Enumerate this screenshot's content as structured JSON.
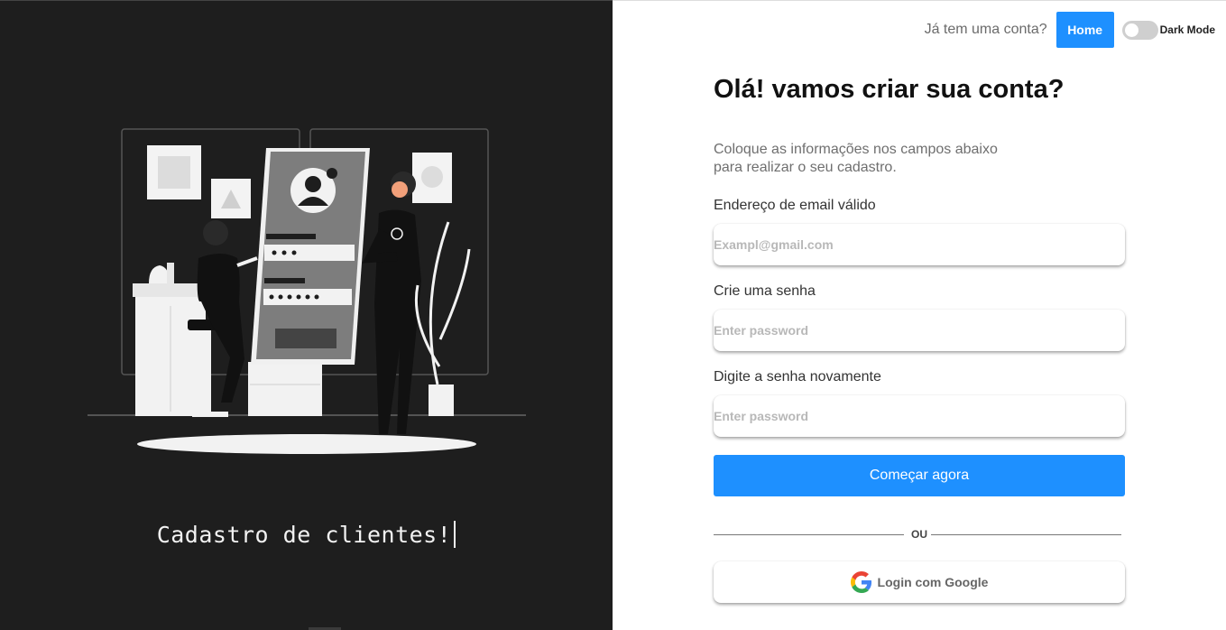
{
  "left": {
    "tagline": "Cadastro de clientes!"
  },
  "topbar": {
    "question": "Já tem uma conta?",
    "home_label": "Home",
    "dark_mode_label": "Dark Mode",
    "dark_mode_on": false
  },
  "form": {
    "title": "Olá! vamos criar sua conta?",
    "subtitle_line1": "Coloque as informações nos campos abaixo",
    "subtitle_line2": "para realizar o seu cadastro.",
    "email_label": "Endereço de email válido",
    "email_placeholder": "Exampl@gmail.com",
    "password_label": "Crie uma senha",
    "password_placeholder": "Enter password",
    "confirm_label": "Digite a senha novamente",
    "confirm_placeholder": "Enter password",
    "submit_label": "Começar agora",
    "divider_text": "OU",
    "google_label": "Login com Google"
  },
  "colors": {
    "accent": "#1e90ff",
    "left_panel_bg": "#1e1e1e"
  },
  "icons": {
    "google": "google-g-icon",
    "avatar": "user-avatar-icon"
  }
}
